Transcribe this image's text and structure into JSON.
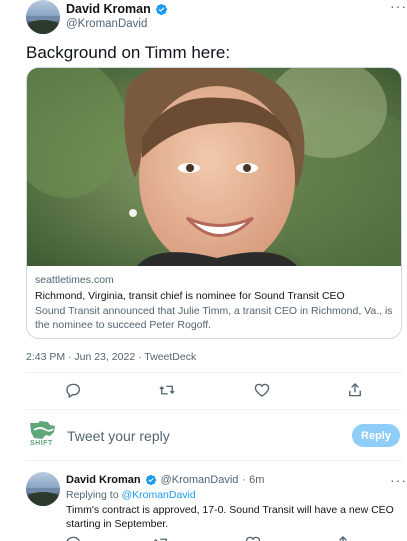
{
  "tweet": {
    "author_name": "David Kroman",
    "author_handle": "@KromanDavid",
    "text": "Background on Timm here:",
    "timestamp": "2:43 PM · Jun 23, 2022 · TweetDeck"
  },
  "card": {
    "domain": "seattletimes.com",
    "title": "Richmond, Virginia, transit chief is nominee for Sound Transit CEO",
    "description": "Sound Transit announced that Julie Timm, a transit CEO in Richmond, Va., is the nominee to succeed Peter Rogoff."
  },
  "actions": [
    "reply-icon",
    "retweet-icon",
    "like-icon",
    "share-icon"
  ],
  "composer": {
    "logo_text": "SHIFT",
    "placeholder": "Tweet your reply",
    "button_label": "Reply"
  },
  "reply_tweet": {
    "author_name": "David Kroman",
    "author_handle": "@KromanDavid",
    "time": "· 6m",
    "replying_prefix": "Replying to",
    "replying_to": "@KromanDavid",
    "text_line1": "Timm's contract is approved, 17-0. Sound Transit will have a new CEO",
    "text_line2": "starting in September."
  },
  "colors": {
    "accent": "#1d9bf0",
    "reply_button": "#8ecdf8",
    "shift_logo": "#5fa77a"
  }
}
